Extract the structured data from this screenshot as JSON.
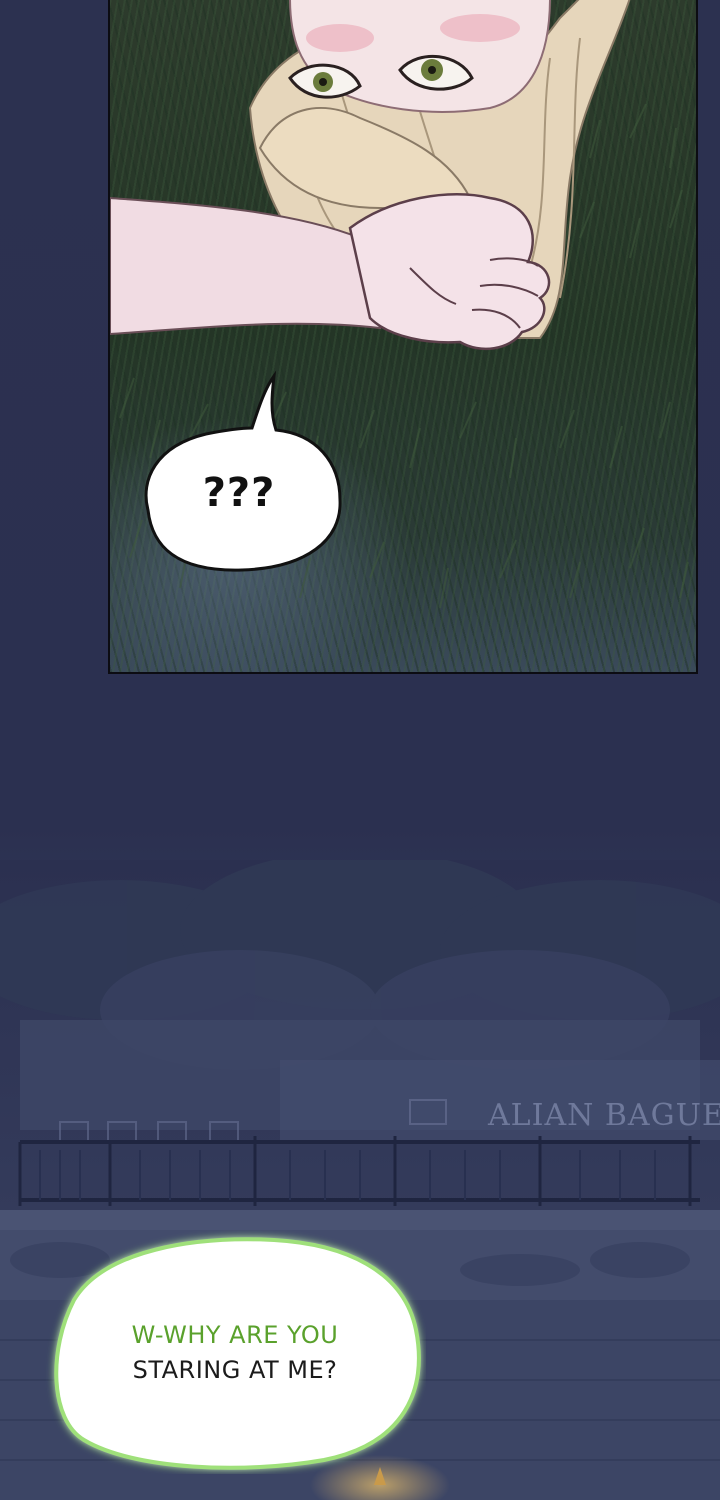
{
  "panels": [
    {
      "bubble_text": "???"
    },
    {
      "sign_text": "ALIAN BAGUE",
      "bubble_lines": [
        "W-WHY ARE YOU",
        "STARING AT ME?"
      ]
    }
  ],
  "colors": {
    "page_background": "#2b3050",
    "grass": "#243526",
    "skin": "#f2dee4",
    "hair": "#e8d9bf",
    "bubble_fill": "#ffffff",
    "bubble_outline": "#111111",
    "glow_outline": "#9fe07a",
    "green_text": "#5aa12c"
  }
}
